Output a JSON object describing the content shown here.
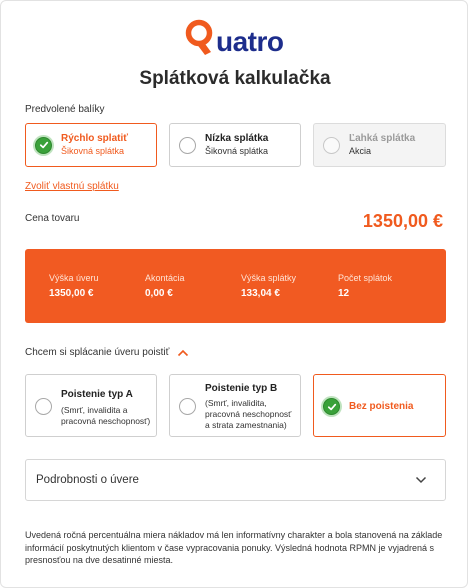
{
  "brand": {
    "logo_rest": "uatro",
    "logo_letter": "Q",
    "color_primary": "#f05a1e",
    "color_logo_text": "#1d2d8c"
  },
  "title": "Splátková kalkulačka",
  "packages": {
    "label": "Predvolené balíky",
    "items": [
      {
        "title": "Rýchlo splatiť",
        "subtitle": "Šikovná splátka",
        "state": "selected"
      },
      {
        "title": "Nízka splátka",
        "subtitle": "Šikovná splátka",
        "state": "default"
      },
      {
        "title": "Ľahká splátka",
        "subtitle": "Akcia",
        "state": "disabled"
      }
    ]
  },
  "custom_link": "Zvoliť vlastnú splátku",
  "price": {
    "label": "Cena tovaru",
    "value": "1350,00 €"
  },
  "summary": [
    {
      "label": "Výška úveru",
      "value": "1350,00 €"
    },
    {
      "label": "Akontácia",
      "value": "0,00 €"
    },
    {
      "label": "Výška splátky",
      "value": "133,04 €"
    },
    {
      "label": "Počet splátok",
      "value": "12"
    }
  ],
  "insurance": {
    "question": "Chcem si splácanie úveru poistiť",
    "options": [
      {
        "title": "Poistenie typ A",
        "desc": [
          "(Smrť, invalidita a",
          "pracovná neschopnosť)"
        ],
        "state": "default"
      },
      {
        "title": "Poistenie typ B",
        "desc": [
          "(Smrť, invalidita,",
          "pracovná neschopnosť",
          "a strata zamestnania)"
        ],
        "state": "default"
      },
      {
        "title": "Bez poistenia",
        "desc": [],
        "state": "selected"
      }
    ]
  },
  "details_label": "Podrobnosti o úvere",
  "footnote": "Uvedená ročná percentuálna miera nákladov má len informatívny charakter a bola stanovená na základe informácií poskytnutých klientom v čase vypracovania ponuky. Výsledná hodnota RPMN je vyjadrená s presnosťou na dve desatinné miesta."
}
